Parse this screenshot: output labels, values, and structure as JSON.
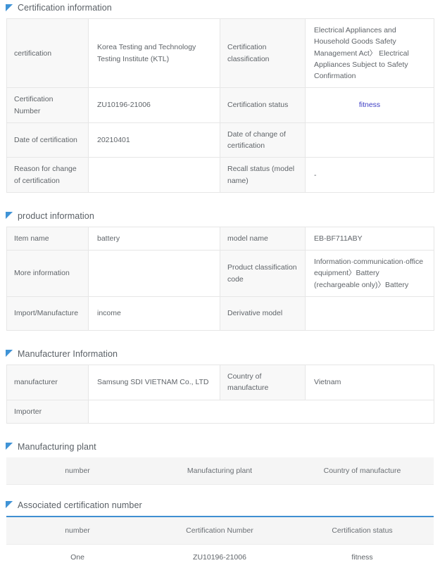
{
  "theme": {
    "marker_color": "#3f93d6",
    "accent_line": "#3f8fd2",
    "status_color": "#3d3dc4",
    "label_bg": "#f8f8f8",
    "header_bg": "#f5f5f5",
    "border": "#e6e6e6",
    "text": "#5f6469"
  },
  "sections": {
    "certification": {
      "title": "Certification information",
      "marker_icon": "flag-marker-icon",
      "rows": [
        {
          "label_1": "certification",
          "value_1": "Korea Testing and Technology Testing Institute (KTL)",
          "label_2": "Certification classification",
          "value_2": "Electrical Appliances and Household Goods Safety Management Act〉 Electrical Appliances Subject to Safety Confirmation"
        },
        {
          "label_1": "Certification Number",
          "value_1": "ZU10196-21006",
          "label_2": "Certification status",
          "value_2": "fitness"
        },
        {
          "label_1": "Date of certification",
          "value_1": "20210401",
          "label_2": "Date of change of certification",
          "value_2": ""
        },
        {
          "label_1": "Reason for change of certification",
          "value_1": "",
          "label_2": "Recall status (model name)",
          "value_2": "-"
        }
      ]
    },
    "product": {
      "title": "product information",
      "marker_icon": "flag-marker-icon",
      "rows": [
        {
          "label_1": "Item name",
          "value_1": "battery",
          "label_2": "model name",
          "value_2": "EB-BF711ABY"
        },
        {
          "label_1": "More information",
          "value_1": "",
          "label_2": "Product classification code",
          "value_2": "Information·communication·office equipment〉Battery (rechargeable only)〉Battery"
        },
        {
          "label_1": "Import/Manufacture",
          "value_1": "income",
          "label_2": "Derivative model",
          "value_2": ""
        }
      ]
    },
    "manufacturer": {
      "title": "Manufacturer Information",
      "marker_icon": "flag-marker-icon",
      "rows": [
        {
          "label_1": "manufacturer",
          "value_1": "Samsung SDI VIETNAM Co., LTD",
          "label_2": "Country of manufacture",
          "value_2": "Vietnam"
        }
      ],
      "importer_label": "Importer",
      "importer_value": ""
    },
    "manufacturing_plant": {
      "title": "Manufacturing plant",
      "marker_icon": "flag-marker-icon",
      "columns": [
        "number",
        "Manufacturing plant",
        "Country of manufacture"
      ],
      "rows": []
    },
    "associated": {
      "title": "Associated certification number",
      "marker_icon": "flag-marker-icon",
      "columns": [
        "number",
        "Certification Number",
        "Certification status"
      ],
      "rows": [
        {
          "number": "One",
          "certification_number": "ZU10196-21006",
          "certification_status": "fitness"
        }
      ]
    }
  }
}
